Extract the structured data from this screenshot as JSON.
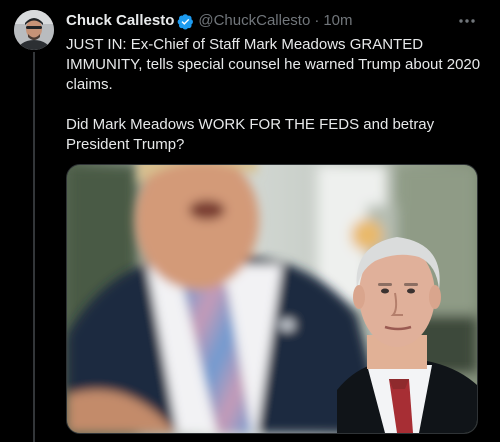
{
  "tweet": {
    "display_name": "Chuck Callesto",
    "handle": "@ChuckCallesto",
    "separator": "·",
    "time": "10m",
    "paragraphs": [
      "JUST IN: Ex-Chief of Staff Mark Meadows GRANTED IMMUNITY, tells special counsel he warned Trump about 2020 claims.",
      "Did Mark Meadows WORK FOR THE FEDS and betray President Trump?"
    ],
    "verified": true
  },
  "icons": {
    "verified": "verified-badge-icon",
    "more": "more-options-icon"
  },
  "colors": {
    "background": "#000000",
    "text_primary": "#e7e9ea",
    "text_secondary": "#71767b",
    "verified_blue": "#1d9bf0",
    "thread_line": "#333639"
  }
}
